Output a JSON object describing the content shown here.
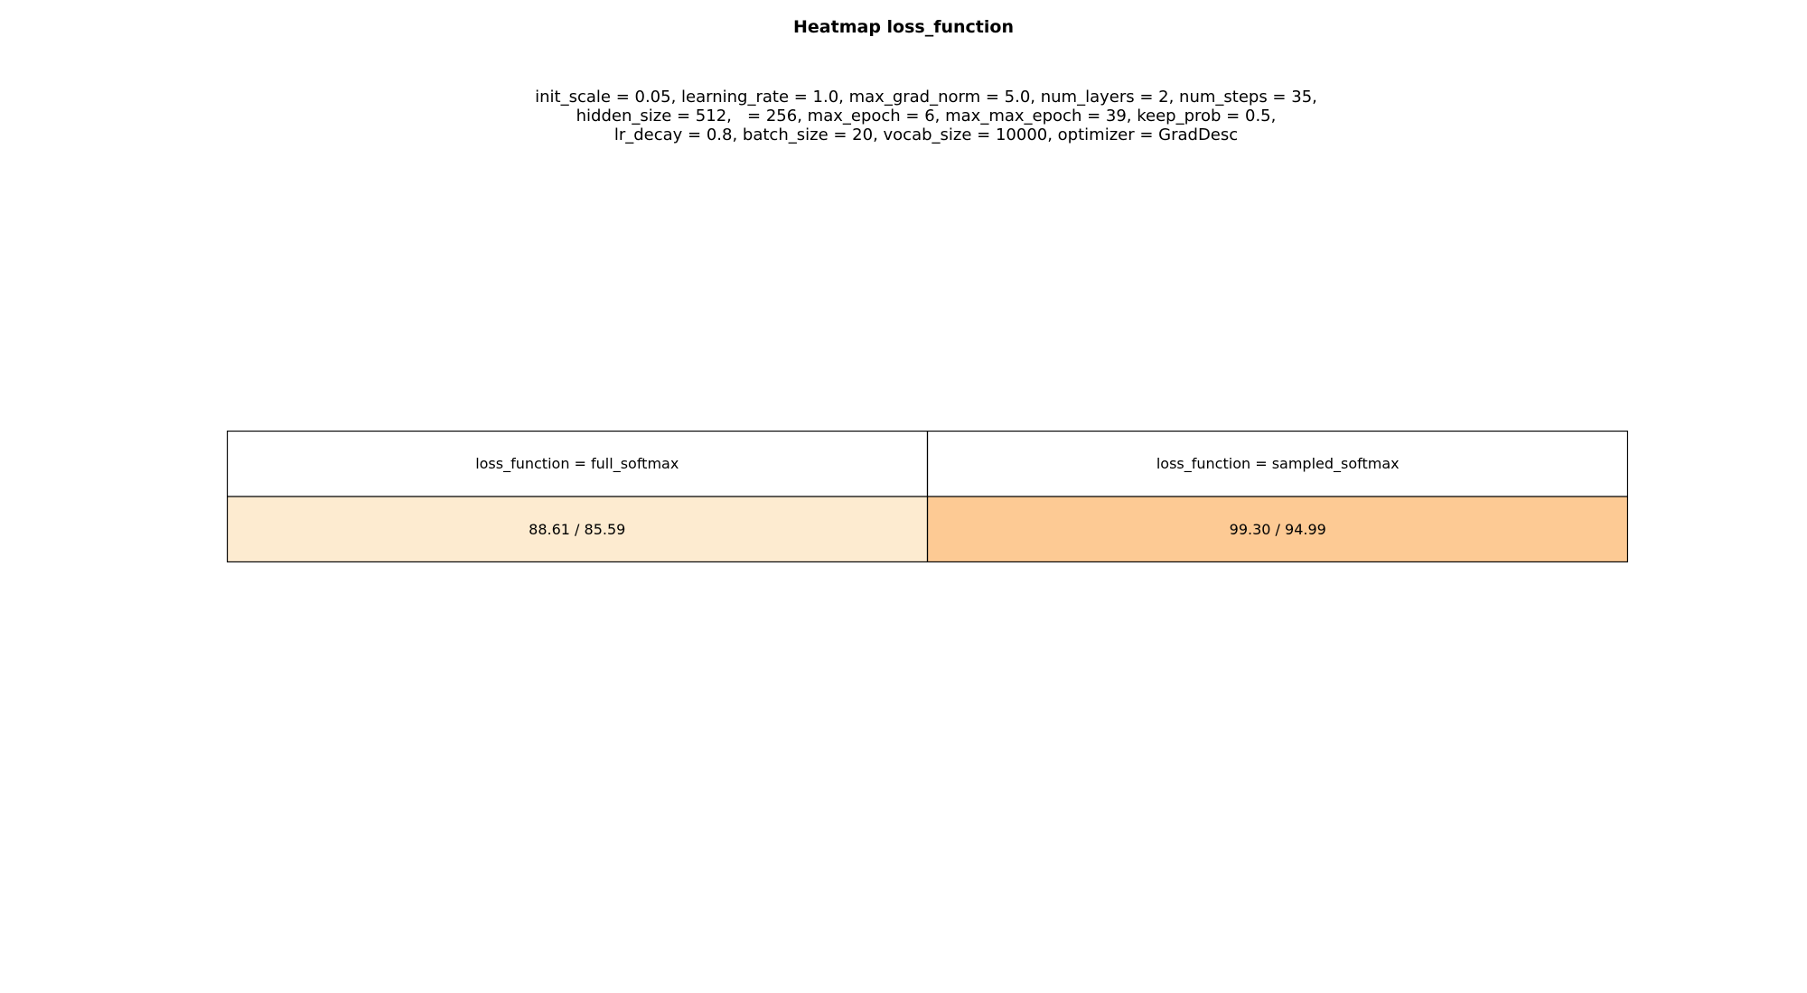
{
  "title": "Heatmap loss_function",
  "subtitle_lines": [
    "init_scale = 0.05, learning_rate = 1.0, max_grad_norm = 5.0, num_layers = 2, num_steps = 35,",
    "hidden_size = 512,   = 256, max_epoch = 6, max_max_epoch = 39, keep_prob = 0.5,",
    "lr_decay = 0.8, batch_size = 20, vocab_size = 10000, optimizer = GradDesc"
  ],
  "chart_data": {
    "type": "heatmap",
    "title": "Heatmap loss_function",
    "columns": [
      "loss_function = full_softmax",
      "loss_function = sampled_softmax"
    ],
    "cells": [
      {
        "label": "88.61 / 85.59",
        "values": [
          88.61,
          85.59
        ],
        "color": "#fdebd0"
      },
      {
        "label": "99.30 / 94.99",
        "values": [
          99.3,
          94.99
        ],
        "color": "#fdca94"
      }
    ]
  }
}
